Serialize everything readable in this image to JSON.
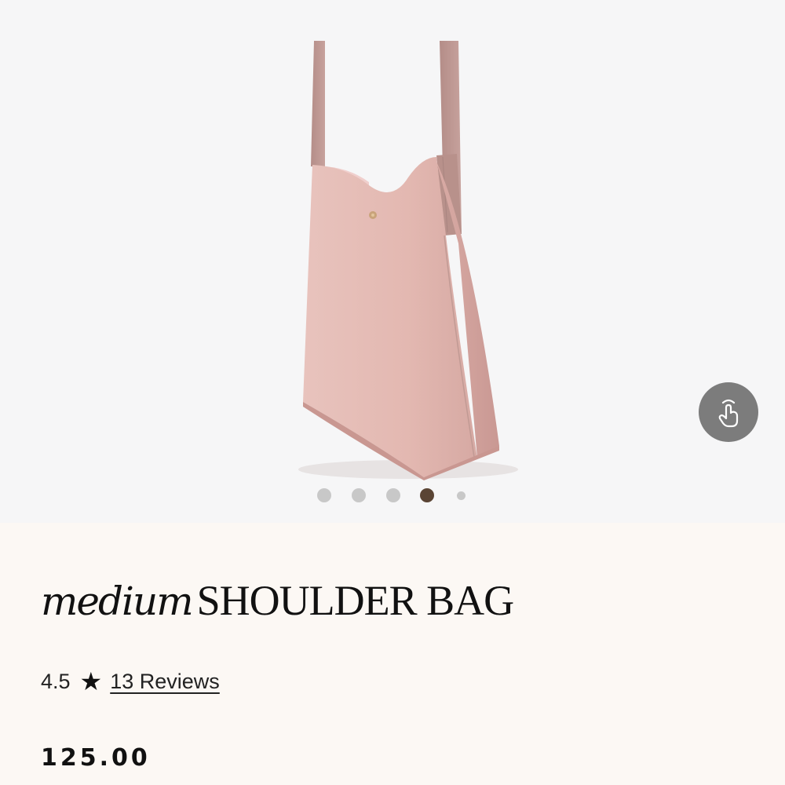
{
  "product": {
    "title_script": "medium",
    "title_caps": "SHOULDER BAG",
    "rating_value": "4.5",
    "rating_star": "★",
    "reviews_link": "13 Reviews",
    "price": "125.00",
    "image_icon": "pink-shoulder-bag-image"
  },
  "gallery": {
    "slide_count": 5,
    "active_slide": 4,
    "swipe_hint_icon": "swipe-hand-icon"
  },
  "colors": {
    "gallery_bg": "#f6f6f7",
    "info_bg": "#fcf8f4",
    "bag_pink": "#e2bab4",
    "strap": "#bf9a95",
    "dot_inactive": "#c8c8c8",
    "dot_active": "#5a4434",
    "hint_bg": "#7c7c7c"
  }
}
